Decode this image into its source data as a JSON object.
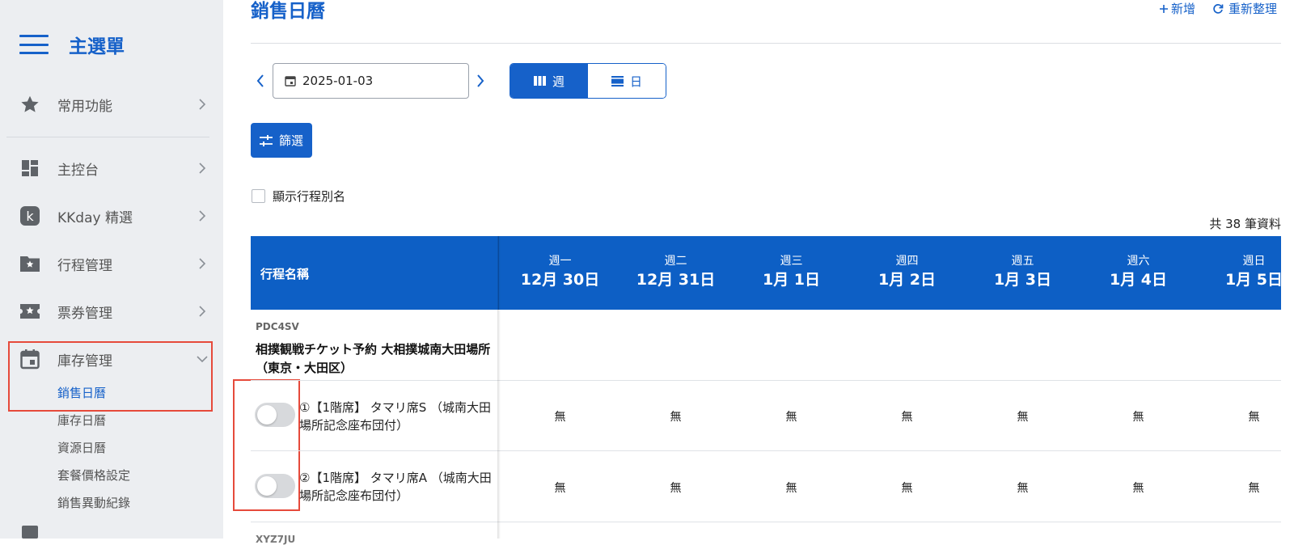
{
  "sidebar": {
    "title": "主選單",
    "items": [
      {
        "label": "常用功能",
        "icon": "star-icon"
      },
      {
        "label": "主控台",
        "icon": "dashboard-icon"
      },
      {
        "label": "KKday 精選",
        "icon": "kkday-logo-icon"
      },
      {
        "label": "行程管理",
        "icon": "folder-star-icon"
      },
      {
        "label": "票券管理",
        "icon": "ticket-icon"
      },
      {
        "label": "庫存管理",
        "icon": "calendar-icon"
      }
    ],
    "sub_items": [
      {
        "label": "銷售日曆",
        "active": true
      },
      {
        "label": "庫存日曆"
      },
      {
        "label": "資源日曆"
      },
      {
        "label": "套餐價格設定"
      },
      {
        "label": "銷售異動紀錄"
      }
    ]
  },
  "header": {
    "title": "銷售日曆",
    "add_label": "新增",
    "refresh_label": "重新整理"
  },
  "toolbar": {
    "date_value": "2025-01-03",
    "view_week_label": "週",
    "view_day_label": "日",
    "filter_label": "篩選",
    "show_alias_label": "顯示行程別名",
    "total_label": "共 38 筆資料"
  },
  "table": {
    "name_header": "行程名稱",
    "days": [
      {
        "weekday": "週一",
        "date": "12月 30日"
      },
      {
        "weekday": "週二",
        "date": "12月 31日"
      },
      {
        "weekday": "週三",
        "date": "1月 1日"
      },
      {
        "weekday": "週四",
        "date": "1月 2日"
      },
      {
        "weekday": "週五",
        "date": "1月 3日"
      },
      {
        "weekday": "週六",
        "date": "1月 4日"
      },
      {
        "weekday": "週日",
        "date": "1月 5日"
      }
    ],
    "product": {
      "code": "PDC4SV",
      "name": "相撲観戦チケット予約 大相撲城南大田場所（東京・大田区）"
    },
    "packages": [
      {
        "name": "①【1階席】 タマリ席S （城南大田場所記念座布団付）",
        "enabled": false,
        "cells": [
          "無",
          "無",
          "無",
          "無",
          "無",
          "無",
          "無"
        ]
      },
      {
        "name": "②【1階席】 タマリ席A （城南大田場所記念座布団付）",
        "enabled": false,
        "cells": [
          "無",
          "無",
          "無",
          "無",
          "無",
          "無",
          "無"
        ]
      }
    ],
    "next_product_code": "XYZ7JU"
  },
  "colors": {
    "primary": "#1661c9",
    "table_header": "#0d5fc5",
    "highlight": "#e64a3b",
    "sidebar_bg": "#eceef1"
  }
}
